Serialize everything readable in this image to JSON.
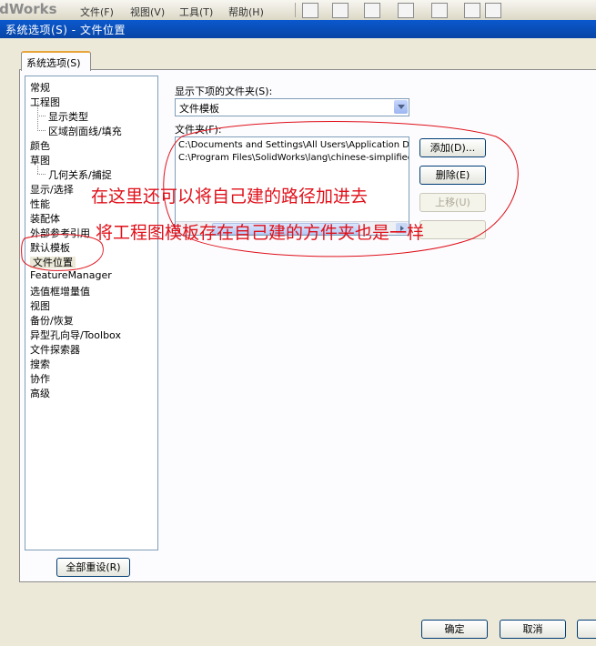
{
  "app": {
    "brand": "idWorks",
    "menus": [
      "文件(F)",
      "视图(V)",
      "工具(T)",
      "帮助(H)"
    ]
  },
  "dialog": {
    "title": "系统选项(S) - 文件位置",
    "tab": "系统选项(S)"
  },
  "tree": {
    "items": [
      {
        "label": "常规",
        "level": 0
      },
      {
        "label": "工程图",
        "level": 0
      },
      {
        "label": "显示类型",
        "level": 1
      },
      {
        "label": "区域剖面线/填充",
        "level": 1
      },
      {
        "label": "颜色",
        "level": 0
      },
      {
        "label": "草图",
        "level": 0
      },
      {
        "label": "几何关系/捕捉",
        "level": 1
      },
      {
        "label": "显示/选择",
        "level": 0
      },
      {
        "label": "性能",
        "level": 0
      },
      {
        "label": "装配体",
        "level": 0
      },
      {
        "label": "外部参考引用",
        "level": 0
      },
      {
        "label": "默认模板",
        "level": 0
      },
      {
        "label": "文件位置",
        "level": 0,
        "selected": true
      },
      {
        "label": "FeatureManager",
        "level": 0
      },
      {
        "label": "选值框增量值",
        "level": 0
      },
      {
        "label": "视图",
        "level": 0
      },
      {
        "label": "备份/恢复",
        "level": 0
      },
      {
        "label": "异型孔向导/Toolbox",
        "level": 0
      },
      {
        "label": "文件探索器",
        "level": 0
      },
      {
        "label": "搜索",
        "level": 0
      },
      {
        "label": "协作",
        "level": 0
      },
      {
        "label": "高级",
        "level": 0
      }
    ],
    "reset_label": "全部重设(R)"
  },
  "main": {
    "show_folders_label": "显示下项的文件夹(S):",
    "folder_type_value": "文件模板",
    "folders_label": "文件夹(F):",
    "folders": [
      "C:\\Documents and Settings\\All Users\\Application Dat",
      "C:\\Program Files\\SolidWorks\\lang\\chinese-simplified\\"
    ],
    "add_label": "添加(D)...",
    "delete_label": "删除(E)",
    "move_up_label": "上移(U)"
  },
  "footer": {
    "ok_label": "确定",
    "cancel_label": "取消"
  },
  "annotations": {
    "line1": "在这里还可以将自己建的路径加进去",
    "line2": "将工程图模板存在自己建的方件夹也是一样",
    "color": "#e0101a"
  }
}
